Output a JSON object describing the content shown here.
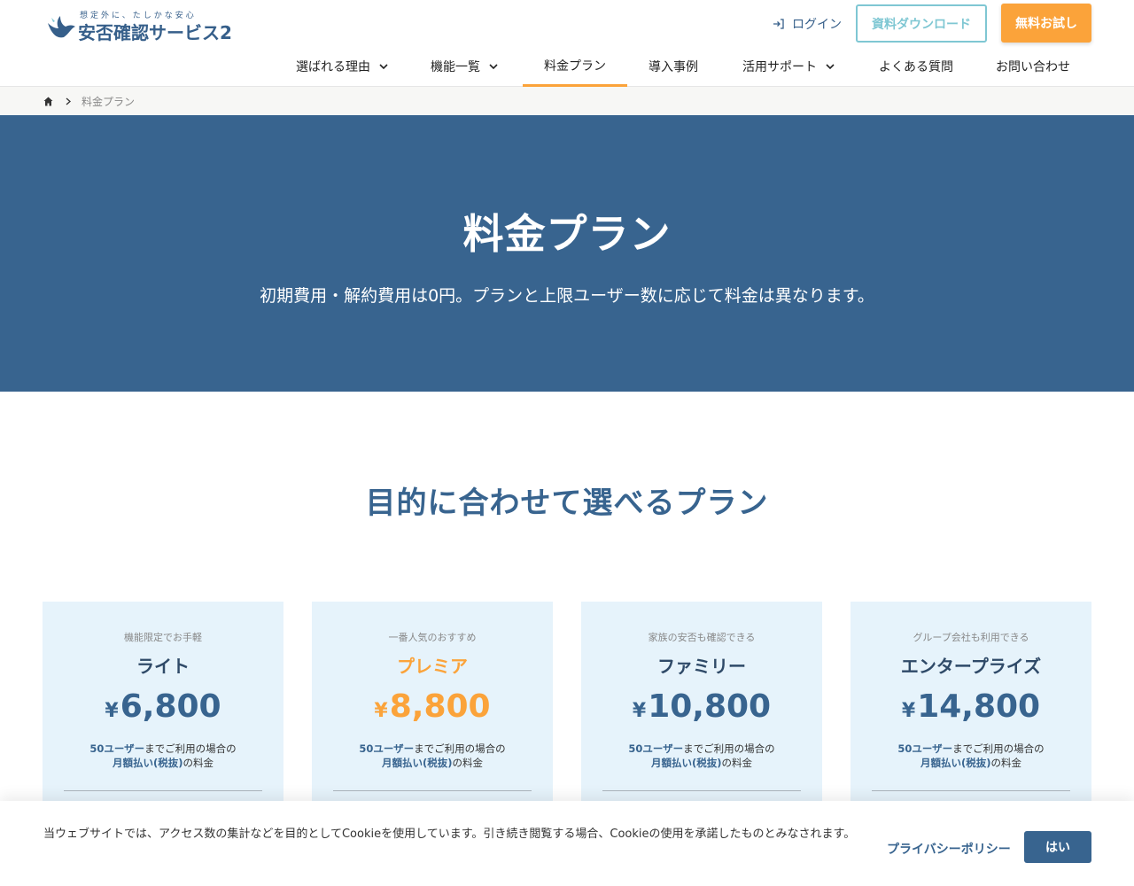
{
  "header": {
    "logo_tagline": "想定外に、たしかな安心",
    "logo_name": "安否確認サービス2",
    "login_label": "ログイン",
    "download_label": "資料ダウンロード",
    "trial_label": "無料お試し"
  },
  "nav": {
    "items": [
      {
        "label": "選ばれる理由",
        "has_dropdown": true
      },
      {
        "label": "機能一覧",
        "has_dropdown": true
      },
      {
        "label": "料金プラン",
        "active": true
      },
      {
        "label": "導入事例"
      },
      {
        "label": "活用サポート",
        "has_dropdown": true
      },
      {
        "label": "よくある質問"
      },
      {
        "label": "お問い合わせ"
      }
    ]
  },
  "breadcrumb": {
    "current": "料金プラン"
  },
  "hero": {
    "title": "料金プラン",
    "subtitle": "初期費用・解約費用は0円。プランと上限ユーザー数に応じて料金は異なります。"
  },
  "plans_section": {
    "title": "目的に合わせて選べるプラン",
    "plans": [
      {
        "tagline": "機能限定でお手軽",
        "name": "ライト",
        "currency": "¥",
        "price": "6,800",
        "note_bold1": "50ユーザー",
        "note1": "までご利用の場合の",
        "note_bold2": "月額払い(税抜)",
        "note2": "の料金"
      },
      {
        "tagline": "一番人気のおすすめ",
        "name": "プレミア",
        "currency": "¥",
        "price": "8,800",
        "note_bold1": "50ユーザー",
        "note1": "までご利用の場合の",
        "note_bold2": "月額払い(税抜)",
        "note2": "の料金"
      },
      {
        "tagline": "家族の安否も確認できる",
        "name": "ファミリー",
        "currency": "¥",
        "price": "10,800",
        "note_bold1": "50ユーザー",
        "note1": "までご利用の場合の",
        "note_bold2": "月額払い(税抜)",
        "note2": "の料金"
      },
      {
        "tagline": "グループ会社も利用できる",
        "name": "エンタープライズ",
        "currency": "¥",
        "price": "14,800",
        "note_bold1": "50ユーザー",
        "note1": "までご利用の場合の",
        "note_bold2": "月額払い(税抜)",
        "note2": "の料金"
      }
    ]
  },
  "cookie": {
    "text": "当ウェブサイトでは、アクセス数の集計などを目的としてCookieを使用しています。引き続き閲覧する場合、Cookieの使用を承諾したものとみなされます。",
    "policy_label": "プライバシーポリシー",
    "accept_label": "はい"
  },
  "colors": {
    "brand_blue": "#38648f",
    "accent_orange": "#fba33a",
    "teal": "#7fc7d3",
    "plan_card_bg": "#e6f3fb"
  }
}
